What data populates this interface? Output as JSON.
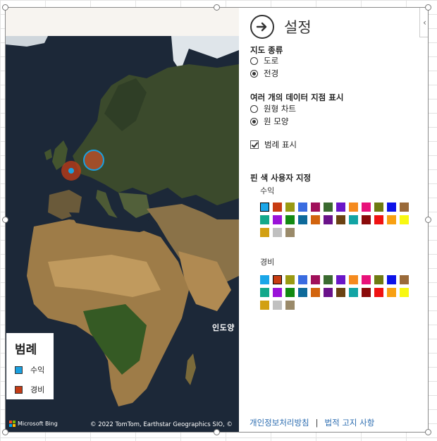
{
  "map": {
    "ocean_label": "인도양",
    "legend": {
      "title": "범례",
      "items": [
        {
          "label": "수익",
          "color": "#1aa0e0"
        },
        {
          "label": "경비",
          "color": "#c43c16"
        }
      ]
    },
    "bing_label": "Microsoft Bing",
    "copyright": "© 2022 TomTom, Earthstar Geographics SIO, ©"
  },
  "settings": {
    "title": "설정",
    "map_type": {
      "label": "지도 종류",
      "options": [
        {
          "label": "도로",
          "checked": false
        },
        {
          "label": "전경",
          "checked": true
        }
      ]
    },
    "multi_points": {
      "label": "여러 개의 데이터 지점 표시",
      "options": [
        {
          "label": "원형 차트",
          "checked": false
        },
        {
          "label": "원 모양",
          "checked": true
        }
      ]
    },
    "show_legend": {
      "label": "범례 표시",
      "checked": true
    },
    "pin_colors": {
      "label": "핀 색 사용자 지정",
      "series": [
        {
          "name": "수익",
          "selected_index": 0
        },
        {
          "name": "경비",
          "selected_index": 1
        }
      ],
      "palette": [
        "#1aa6e8",
        "#c83c12",
        "#9a9a12",
        "#3a6ce0",
        "#a0105a",
        "#3a6a30",
        "#6a16c8",
        "#f58a1e",
        "#e8117a",
        "#6e7a12",
        "#0d12e8",
        "#9a6a3a",
        "#12a88a",
        "#9a12d8",
        "#128a12",
        "#0e6a9a",
        "#d2640e",
        "#6a128a",
        "#6a4212",
        "#12a4a4",
        "#8a0a0a",
        "#f01212",
        "#f8a012",
        "#f8f812",
        "#d2a012",
        "#c0c0c0",
        "#9a8a6a"
      ]
    },
    "footer": {
      "privacy": "개인정보처리방침",
      "separator": "|",
      "legal": "법적 고지 사항"
    }
  }
}
